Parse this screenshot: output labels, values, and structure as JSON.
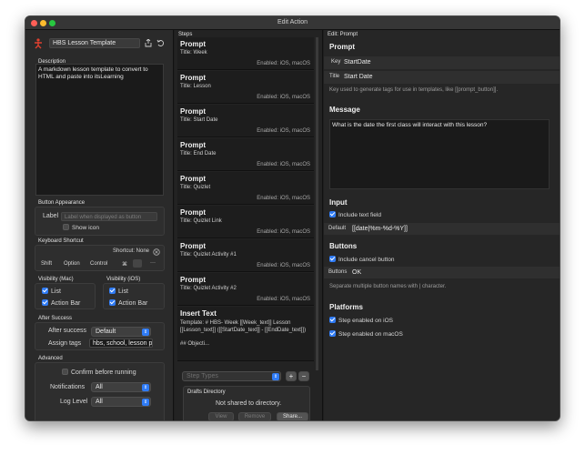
{
  "window": {
    "title": "Edit Action"
  },
  "left": {
    "action_name": "HBS Lesson Template",
    "description_header": "Description",
    "description_text": "A markdown lesson template to convert to HTML and paste into itsLearning",
    "button_appearance_header": "Button Appearance",
    "label_caption": "Label",
    "label_placeholder": "Label when displayed as button",
    "show_icon": "Show icon",
    "shortcut_header": "Keyboard Shortcut",
    "shortcut_status": "Shortcut: None",
    "modifiers": [
      "Shift",
      "Option",
      "Control",
      "⌘"
    ],
    "more": "···",
    "visibility_mac_header": "Visibility (Mac)",
    "visibility_ios_header": "Visibility (iOS)",
    "list_label": "List",
    "action_bar_label": "Action Bar",
    "after_success_header": "After Success",
    "after_success_caption": "After success",
    "after_success_value": "Default",
    "assign_tags_caption": "Assign tags",
    "assign_tags_value": "hbs, school, lesson p",
    "advanced_header": "Advanced",
    "confirm_label": "Confirm before running",
    "notifications_caption": "Notifications",
    "notifications_value": "All",
    "log_level_caption": "Log Level",
    "log_level_value": "All"
  },
  "steps": {
    "header": "Steps",
    "items": [
      {
        "type": "Prompt",
        "title": "Title: Week",
        "enabled": "Enabled: iOS, macOS"
      },
      {
        "type": "Prompt",
        "title": "Title: Lesson",
        "enabled": "Enabled: iOS, macOS"
      },
      {
        "type": "Prompt",
        "title": "Title: Start Date",
        "enabled": "Enabled: iOS, macOS"
      },
      {
        "type": "Prompt",
        "title": "Title: End Date",
        "enabled": "Enabled: iOS, macOS"
      },
      {
        "type": "Prompt",
        "title": "Title: Quizlet",
        "enabled": "Enabled: iOS, macOS"
      },
      {
        "type": "Prompt",
        "title": "Title: Quizlet Link",
        "enabled": "Enabled: iOS, macOS"
      },
      {
        "type": "Prompt",
        "title": "Title: Quizlet Activity #1",
        "enabled": "Enabled: iOS, macOS"
      },
      {
        "type": "Prompt",
        "title": "Title: Quizlet Activity #2",
        "enabled": "Enabled: iOS, macOS"
      }
    ],
    "insert_text": {
      "type": "Insert Text",
      "body": "Template: # HBS- Week [[Week_text]] Lesson [[Lesson_text]] ([[StartDate_text]] - [[EndDate_text]])",
      "tail": "## Objecti..."
    },
    "step_types": "Step Types",
    "plus": "+",
    "minus": "−",
    "drafts_header": "Drafts Directory",
    "drafts_status": "Not shared to directory.",
    "view_button": "View",
    "remove_button": "Remove",
    "share_button": "Share..."
  },
  "right": {
    "header": "Edit: Prompt",
    "prompt_title": "Prompt",
    "key_caption": "Key",
    "key_value": "StartDate",
    "title_caption": "Title",
    "title_value": "Start Date",
    "key_hint": "Key used to generate tags for use in templates, like [[prompt_button]].",
    "message_title": "Message",
    "message_value": "What is the date the first class will interact with this lesson?",
    "input_title": "Input",
    "include_text_field": "Include text field",
    "default_caption": "Default",
    "default_value": "[[date|%m-%d-%Y]]",
    "buttons_title": "Buttons",
    "include_cancel": "Include cancel button",
    "buttons_caption": "Buttons",
    "buttons_value": "OK",
    "buttons_hint": "Separate multiple button names with | character.",
    "platforms_title": "Platforms",
    "enabled_ios": "Step enabled on iOS",
    "enabled_macos": "Step enabled on macOS"
  },
  "colors": {
    "accent": "#2f7bf5",
    "action_icon": "#e0402f"
  },
  "icons": [
    "person-icon",
    "share-icon",
    "undo-icon",
    "clear-icon"
  ]
}
